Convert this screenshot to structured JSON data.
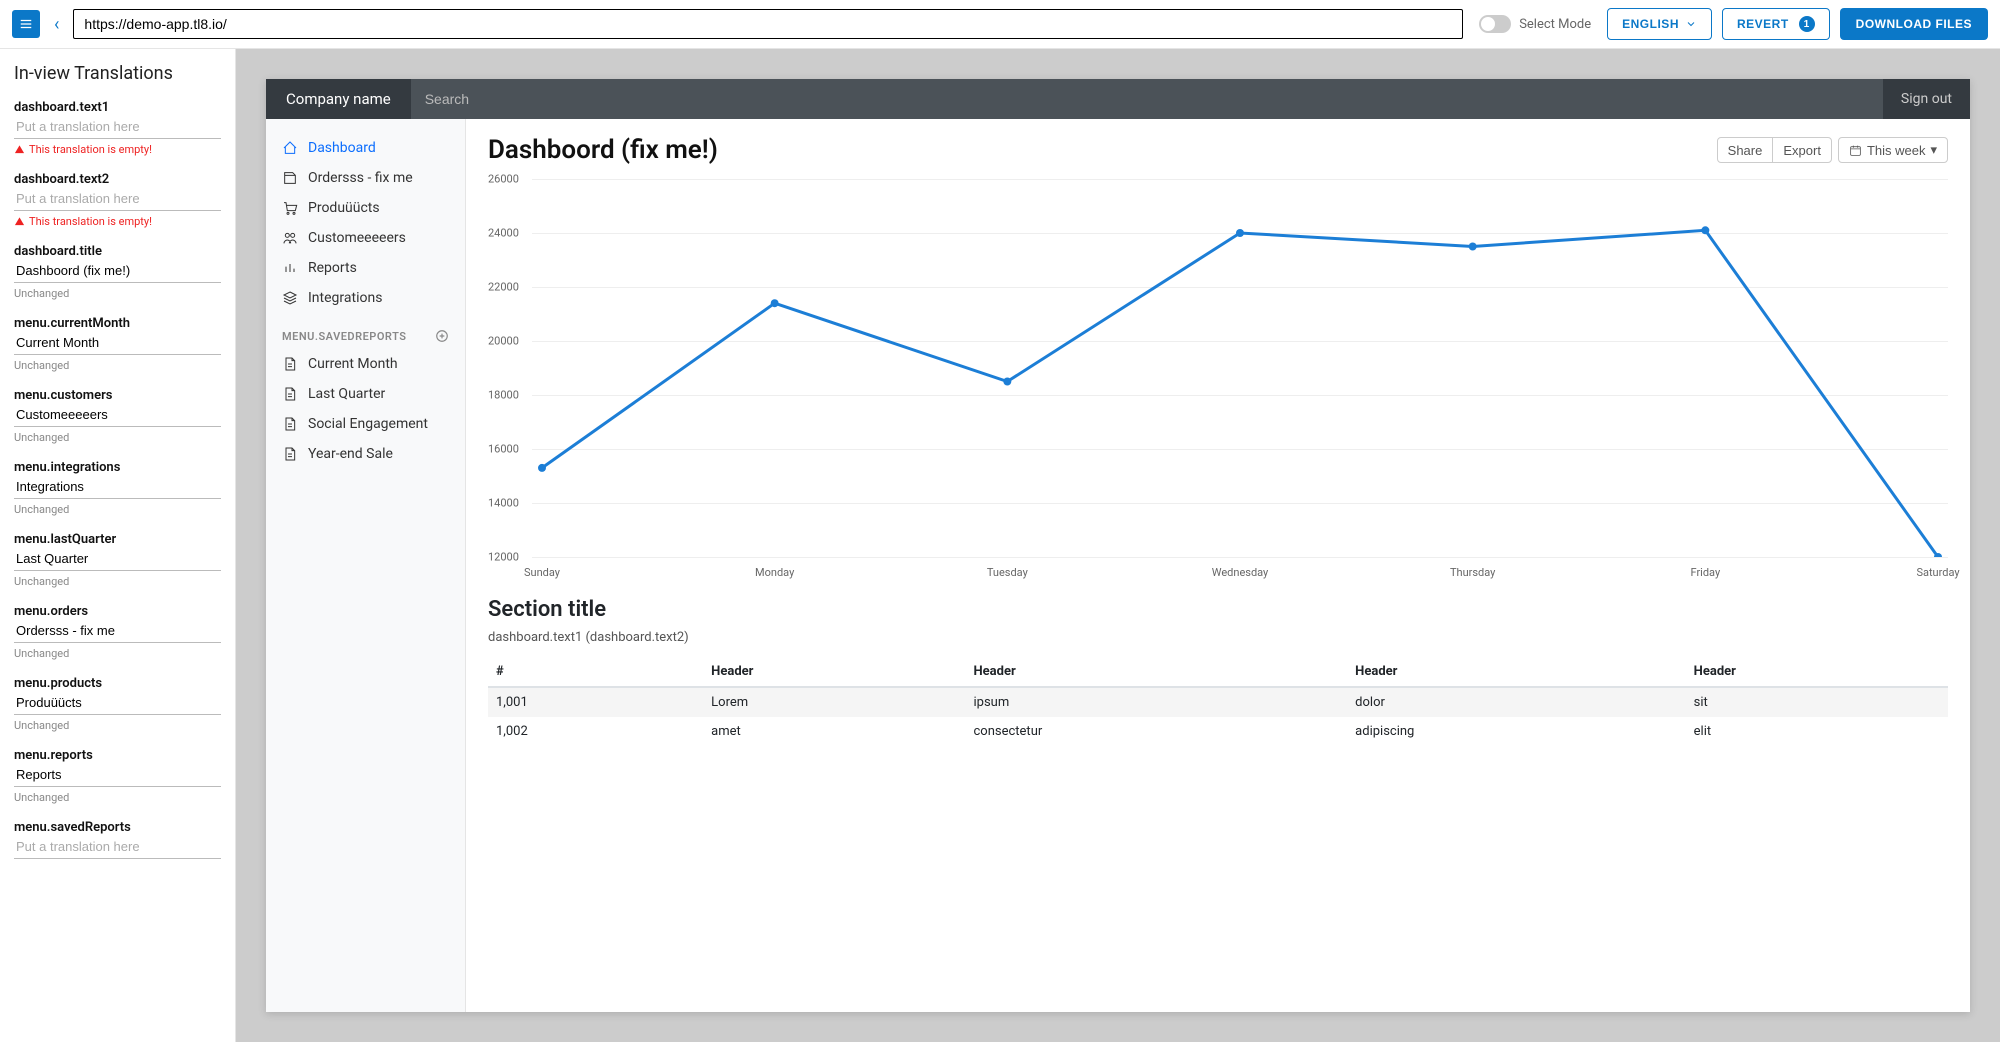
{
  "topbar": {
    "url": "https://demo-app.tl8.io/",
    "select_mode": "Select Mode",
    "language": "ENGLISH",
    "revert": "REVERT",
    "revert_count": "1",
    "download": "DOWNLOAD FILES"
  },
  "left": {
    "title": "In-view Translations",
    "placeholder": "Put a translation here",
    "empty_msg": "This translation is empty!",
    "unchanged": "Unchanged",
    "items": [
      {
        "key": "dashboard.text1",
        "value": "",
        "status": "empty"
      },
      {
        "key": "dashboard.text2",
        "value": "",
        "status": "empty"
      },
      {
        "key": "dashboard.title",
        "value": "Dashboord (fix me!)",
        "status": "unchanged"
      },
      {
        "key": "menu.currentMonth",
        "value": "Current Month",
        "status": "unchanged"
      },
      {
        "key": "menu.customers",
        "value": "Customeeeeers",
        "status": "unchanged"
      },
      {
        "key": "menu.integrations",
        "value": "Integrations",
        "status": "unchanged"
      },
      {
        "key": "menu.lastQuarter",
        "value": "Last Quarter",
        "status": "unchanged"
      },
      {
        "key": "menu.orders",
        "value": "Ordersss - fix me",
        "status": "unchanged"
      },
      {
        "key": "menu.products",
        "value": "Produüücts",
        "status": "unchanged"
      },
      {
        "key": "menu.reports",
        "value": "Reports",
        "status": "unchanged"
      },
      {
        "key": "menu.savedReports",
        "value": "",
        "status": "none"
      }
    ]
  },
  "app": {
    "company": "Company name",
    "search_placeholder": "Search",
    "signout": "Sign out",
    "nav": [
      {
        "label": "Dashboard"
      },
      {
        "label": "Ordersss - fix me"
      },
      {
        "label": "Produüücts"
      },
      {
        "label": "Customeeeeers"
      },
      {
        "label": "Reports"
      },
      {
        "label": "Integrations"
      }
    ],
    "saved_heading": "MENU.SAVEDREPORTS",
    "saved": [
      {
        "label": "Current Month"
      },
      {
        "label": "Last Quarter"
      },
      {
        "label": "Social Engagement"
      },
      {
        "label": "Year-end Sale"
      }
    ],
    "page_title": "Dashboord (fix me!)",
    "share": "Share",
    "export": "Export",
    "this_week": "This week",
    "section_title": "Section title",
    "subtext": "dashboard.text1 (dashboard.text2)",
    "table": {
      "headers": [
        "#",
        "Header",
        "Header",
        "Header",
        "Header"
      ],
      "rows": [
        [
          "1,001",
          "Lorem",
          "ipsum",
          "dolor",
          "sit"
        ],
        [
          "1,002",
          "amet",
          "consectetur",
          "adipiscing",
          "elit"
        ]
      ]
    }
  },
  "chart_data": {
    "type": "line",
    "categories": [
      "Sunday",
      "Monday",
      "Tuesday",
      "Wednesday",
      "Thursday",
      "Friday",
      "Saturday"
    ],
    "values": [
      15300,
      21400,
      18500,
      24000,
      23500,
      24100,
      12000
    ],
    "yticks": [
      12000,
      14000,
      16000,
      18000,
      20000,
      22000,
      24000,
      26000
    ],
    "ylim": [
      12000,
      26000
    ],
    "color": "#1c7ed6"
  }
}
